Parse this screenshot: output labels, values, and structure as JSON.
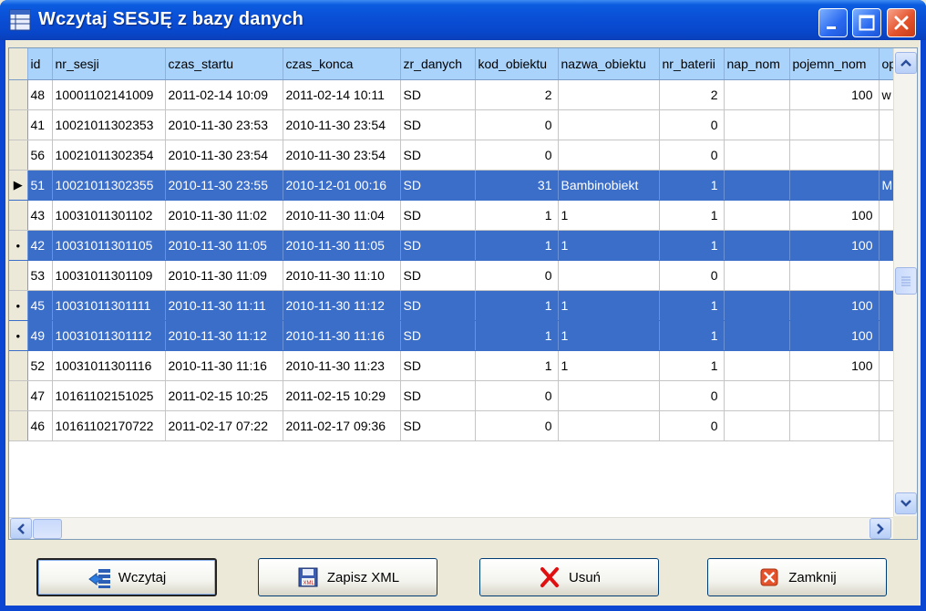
{
  "window": {
    "title": "Wczytaj SESJĘ z bazy danych"
  },
  "columns": [
    "id",
    "nr_sesji",
    "czas_startu",
    "czas_konca",
    "zr_danych",
    "kod_obiektu",
    "nazwa_obiektu",
    "nr_baterii",
    "nap_nom",
    "pojemn_nom",
    "op"
  ],
  "rows": [
    {
      "marker": "",
      "selected": false,
      "cells": [
        "48",
        "10001102141009",
        "2011-02-14 10:09",
        "2011-02-14 10:11",
        "SD",
        "2",
        "",
        "2",
        "",
        "100",
        "w"
      ]
    },
    {
      "marker": "",
      "selected": false,
      "cells": [
        "41",
        "10021011302353",
        "2010-11-30 23:53",
        "2010-11-30 23:54",
        "SD",
        "0",
        "",
        "0",
        "",
        "",
        ""
      ]
    },
    {
      "marker": "",
      "selected": false,
      "cells": [
        "56",
        "10021011302354",
        "2010-11-30 23:54",
        "2010-11-30 23:54",
        "SD",
        "0",
        "",
        "0",
        "",
        "",
        ""
      ]
    },
    {
      "marker": "▶",
      "selected": true,
      "cells": [
        "51",
        "10021011302355",
        "2010-11-30 23:55",
        "2010-12-01 00:16",
        "SD",
        "31",
        "Bambinobiekt",
        "1",
        "",
        "",
        "M"
      ]
    },
    {
      "marker": "",
      "selected": false,
      "cells": [
        "43",
        "10031011301102",
        "2010-11-30 11:02",
        "2010-11-30 11:04",
        "SD",
        "1",
        "1",
        "1",
        "",
        "100",
        ""
      ]
    },
    {
      "marker": "•",
      "selected": true,
      "cells": [
        "42",
        "10031011301105",
        "2010-11-30 11:05",
        "2010-11-30 11:05",
        "SD",
        "1",
        "1",
        "1",
        "",
        "100",
        ""
      ]
    },
    {
      "marker": "",
      "selected": false,
      "cells": [
        "53",
        "10031011301109",
        "2010-11-30 11:09",
        "2010-11-30 11:10",
        "SD",
        "0",
        "",
        "0",
        "",
        "",
        ""
      ]
    },
    {
      "marker": "•",
      "selected": true,
      "cells": [
        "45",
        "10031011301111",
        "2010-11-30 11:11",
        "2010-11-30 11:12",
        "SD",
        "1",
        "1",
        "1",
        "",
        "100",
        ""
      ]
    },
    {
      "marker": "•",
      "selected": true,
      "cells": [
        "49",
        "10031011301112",
        "2010-11-30 11:12",
        "2010-11-30 11:16",
        "SD",
        "1",
        "1",
        "1",
        "",
        "100",
        ""
      ]
    },
    {
      "marker": "",
      "selected": false,
      "cells": [
        "52",
        "10031011301116",
        "2010-11-30 11:16",
        "2010-11-30 11:23",
        "SD",
        "1",
        "1",
        "1",
        "",
        "100",
        ""
      ]
    },
    {
      "marker": "",
      "selected": false,
      "cells": [
        "47",
        "10161102151025",
        "2011-02-15 10:25",
        "2011-02-15 10:29",
        "SD",
        "0",
        "",
        "0",
        "",
        "",
        ""
      ]
    },
    {
      "marker": "",
      "selected": false,
      "cells": [
        "46",
        "10161102170722",
        "2011-02-17 07:22",
        "2011-02-17 09:36",
        "SD",
        "0",
        "",
        "0",
        "",
        "",
        ""
      ]
    }
  ],
  "buttons": {
    "load": "Wczytaj",
    "save_xml": "Zapisz XML",
    "delete": "Usuń",
    "close": "Zamknij"
  },
  "colors": {
    "title_blue": "#0a4fd6",
    "selection": "#3b6ec9",
    "header": "#a9d3fb"
  }
}
